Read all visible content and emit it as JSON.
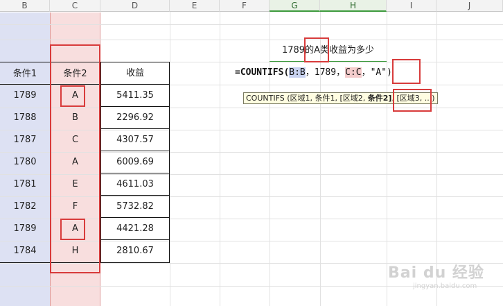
{
  "columns": [
    "B",
    "C",
    "D",
    "E",
    "F",
    "G",
    "H",
    "I",
    "J"
  ],
  "table": {
    "headers": [
      "条件1",
      "条件2",
      "收益"
    ],
    "rows": [
      [
        "1789",
        "A",
        "5411.35"
      ],
      [
        "1788",
        "B",
        "2296.92"
      ],
      [
        "1787",
        "C",
        "4307.57"
      ],
      [
        "1780",
        "A",
        "6009.69"
      ],
      [
        "1781",
        "E",
        "4611.03"
      ],
      [
        "1782",
        "F",
        "5732.82"
      ],
      [
        "1789",
        "A",
        "4421.28"
      ],
      [
        "1784",
        "H",
        "2810.67"
      ]
    ]
  },
  "question": {
    "pre": "1789的",
    "mid": "A类",
    "post": "收益为多少"
  },
  "formula": {
    "prefix": "=COUNTIFS(",
    "arg1": "B:B",
    "sep1": "，1789，",
    "arg3": "C:C",
    "sep2": "，",
    "arg4": "\"A\"",
    "suffix": ")"
  },
  "tooltip": {
    "pre": "COUNTIFS (区域1, 条件1, [区域2, ",
    "bold": "条件2]",
    "post": ", [区域3, ...)"
  },
  "watermark": {
    "text": "Bai du 经验",
    "sub": "jingyan.baidu.com"
  }
}
